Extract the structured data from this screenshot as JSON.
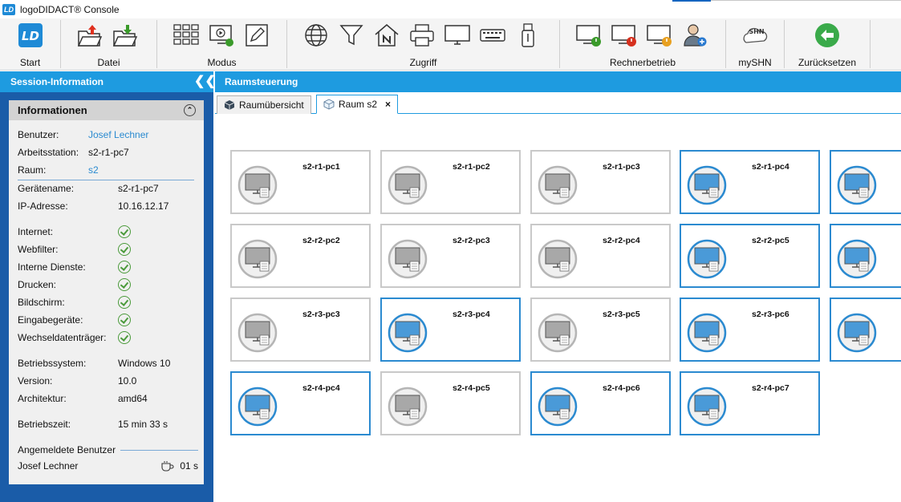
{
  "window": {
    "title": "logoDIDACT® Console",
    "logo": "LD"
  },
  "toolbar": {
    "start_label": "Start",
    "datei_label": "Datei",
    "modus_label": "Modus",
    "zugriff_label": "Zugriff",
    "rechnerbetrieb_label": "Rechnerbetrieb",
    "myshn_label": "mySHN",
    "zuruecksetzen_label": "Zurücksetzen",
    "myshn_icon_text": "SHN"
  },
  "sidebar": {
    "title": "Session-Information",
    "info_title": "Informationen",
    "fields": [
      {
        "k": "Benutzer:",
        "v": "Josef Lechner",
        "link": true
      },
      {
        "k": "Arbeitsstation:",
        "v": "s2-r1-pc7",
        "link": false
      },
      {
        "k": "Raum:",
        "v": "s2",
        "link": true
      },
      {
        "k": "Gerätename:",
        "v": "s2-r1-pc7",
        "link": false
      },
      {
        "k": "IP-Adresse:",
        "v": "10.16.12.17",
        "link": false
      }
    ],
    "status": [
      "Internet:",
      "Webfilter:",
      "Interne Dienste:",
      "Drucken:",
      "Bildschirm:",
      "Eingabegeräte:",
      "Wechseldatenträger:"
    ],
    "system": [
      {
        "k": "Betriebssystem:",
        "v": "Windows 10"
      },
      {
        "k": "Version:",
        "v": "10.0"
      },
      {
        "k": "Architektur:",
        "v": "amd64"
      }
    ],
    "uptime": {
      "k": "Betriebszeit:",
      "v": "15 min 33 s"
    },
    "logged_users_title": "Angemeldete Benutzer",
    "logged_user": {
      "name": "Josef Lechner",
      "time": "01 s"
    }
  },
  "main": {
    "title": "Raumsteuerung",
    "tabs": [
      {
        "label": "Raumübersicht"
      },
      {
        "label": "Raum s2",
        "close": "×"
      }
    ],
    "computers": [
      {
        "name": "s2-r1-pc1",
        "on": false
      },
      {
        "name": "s2-r1-pc2",
        "on": false
      },
      {
        "name": "s2-r1-pc3",
        "on": false
      },
      {
        "name": "s2-r1-pc4",
        "on": true
      },
      {
        "name": "",
        "on": true
      },
      {
        "name": "s2-r2-pc2",
        "on": false
      },
      {
        "name": "s2-r2-pc3",
        "on": false
      },
      {
        "name": "s2-r2-pc4",
        "on": false
      },
      {
        "name": "s2-r2-pc5",
        "on": true
      },
      {
        "name": "",
        "on": true
      },
      {
        "name": "s2-r3-pc3",
        "on": false
      },
      {
        "name": "s2-r3-pc4",
        "on": true
      },
      {
        "name": "s2-r3-pc5",
        "on": false
      },
      {
        "name": "s2-r3-pc6",
        "on": true
      },
      {
        "name": "",
        "on": true
      },
      {
        "name": "s2-r4-pc4",
        "on": true
      },
      {
        "name": "s2-r4-pc5",
        "on": false
      },
      {
        "name": "s2-r4-pc6",
        "on": true
      },
      {
        "name": "s2-r4-pc7",
        "on": true
      }
    ]
  },
  "colors": {
    "accent": "#1e9be0",
    "sidebar": "#1a5ca8",
    "on_border": "#2b8ad0",
    "off_border": "#c9c9c9",
    "ok": "#4a9a3a"
  }
}
